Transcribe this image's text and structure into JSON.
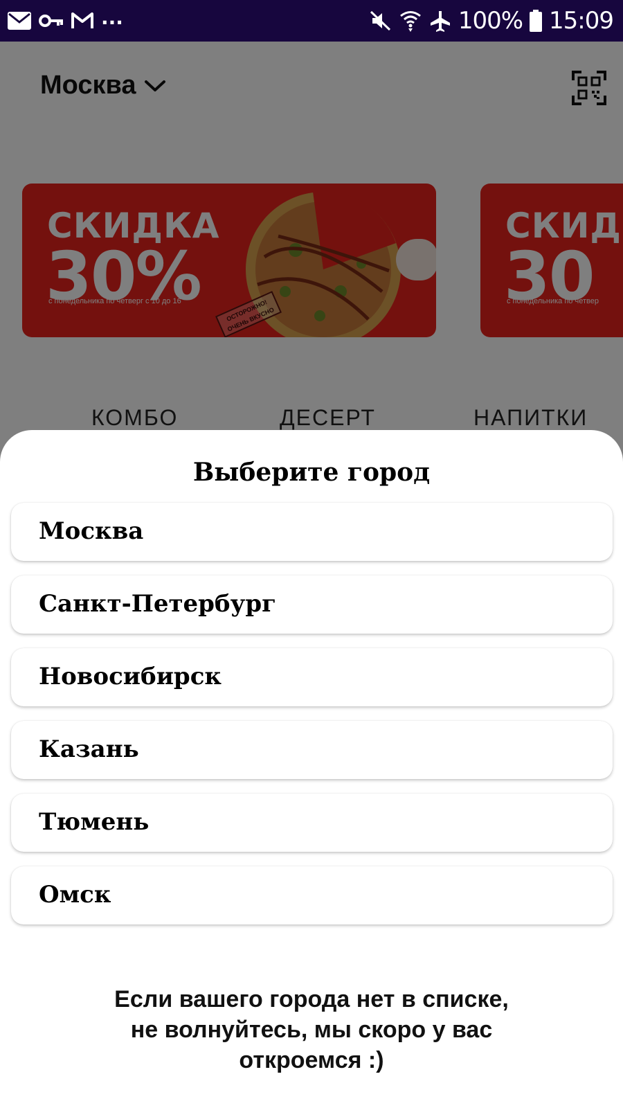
{
  "status_bar": {
    "left_icons": [
      "mail-icon",
      "key-icon",
      "gmail-icon"
    ],
    "overflow": "...",
    "right_icons": [
      "mute-icon",
      "wifi-icon",
      "airplane-icon",
      "battery-icon"
    ],
    "battery": "100%",
    "time": "15:09"
  },
  "header": {
    "city": "Москва",
    "city_icon": "chevron-down-icon",
    "qr_icon": "qr-scan-icon"
  },
  "banners": [
    {
      "title": "СКИДКА",
      "value": "30%",
      "subtitle": "с понедельника по четверг с 10 до 16",
      "stamp": "ОСТОРОЖНО! ОЧЕНЬ ВКУСНО",
      "color": "#e8231c"
    },
    {
      "title": "СКИД",
      "value": "30",
      "subtitle": "с понедельника по четвер",
      "color": "#e8231c"
    }
  ],
  "categories": [
    "КОМБО",
    "ДЕСЕРТ",
    "НАПИТКИ"
  ],
  "sheet": {
    "title": "Выберите город",
    "cities": [
      "Москва",
      "Санкт-Петербург",
      "Новосибирск",
      "Казань",
      "Тюмень",
      "Омск"
    ],
    "notice_lines": [
      "Если вашего города нет в списке,",
      "не волнуйтесь, мы скоро у вас",
      "откроемся :)"
    ]
  },
  "colors": {
    "status_bar_bg": "#17063e",
    "banner_red": "#e8231c",
    "overlay": "rgba(0,0,0,0.5)"
  }
}
